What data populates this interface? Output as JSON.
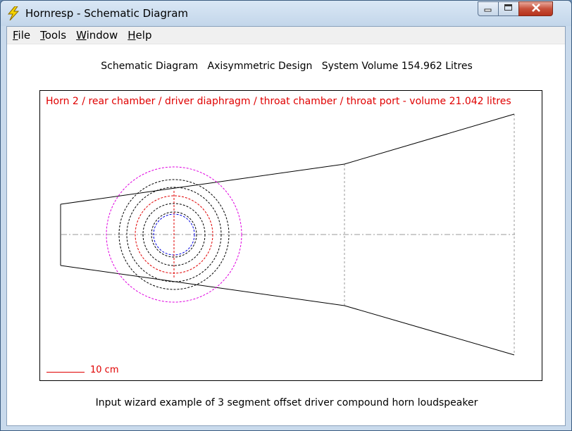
{
  "window": {
    "title": "Hornresp - Schematic Diagram",
    "app_icon": "lightning-bolt-icon",
    "controls": [
      "minimize-icon",
      "maximize-icon",
      "close-icon"
    ]
  },
  "menu": {
    "file": {
      "mnemonic": "F",
      "rest": "ile"
    },
    "tools": {
      "mnemonic": "T",
      "rest": "ools"
    },
    "window": {
      "mnemonic": "W",
      "rest": "indow"
    },
    "help": {
      "mnemonic": "H",
      "rest": "elp"
    }
  },
  "heading": "Schematic Diagram   Axisymmetric Design   System Volume 154.962 Litres",
  "diagram": {
    "caption": "Horn 2 / rear chamber / driver diaphragm / throat chamber / throat port - volume 21.042 litres",
    "scale_label": "10 cm"
  },
  "footer": "Input wizard example of 3 segment offset driver compound horn loudspeaker",
  "colors": {
    "diagram_caption": "#e00000",
    "horn_outline": "#000000",
    "outer_circle": "#e000e0",
    "diaphragm_circle": "#e00000",
    "inner_circle": "#0000e0",
    "axis_line": "#999999"
  }
}
